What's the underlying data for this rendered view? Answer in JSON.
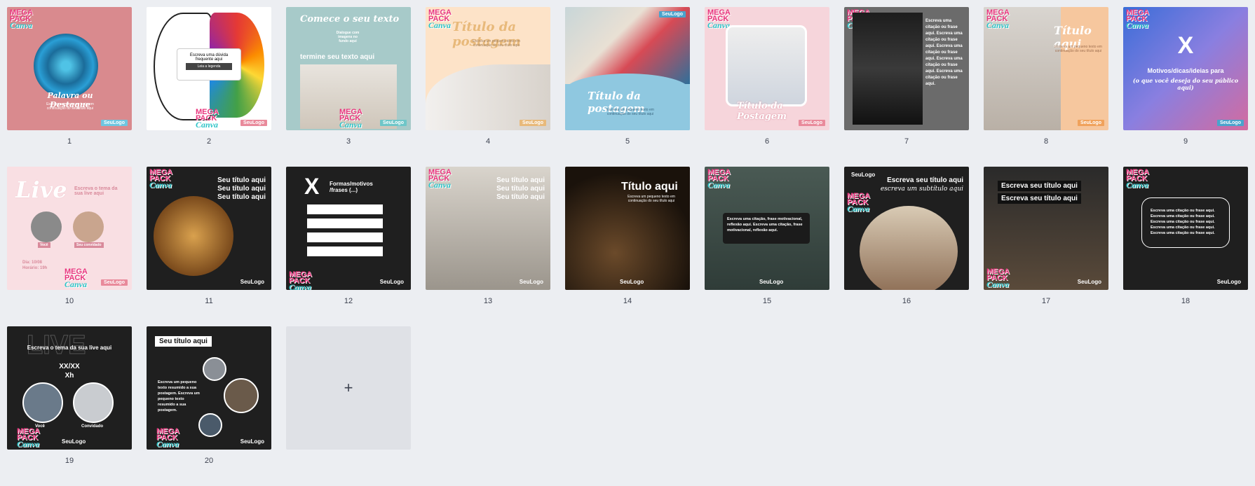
{
  "pages": [
    {
      "n": "1",
      "title": "Palavra ou Destaque",
      "body": "Escreva um pequeno texto em continuação do seu título aqui",
      "logo": "SeuLogo"
    },
    {
      "n": "2",
      "title": "Escreva uma dúvida frequente aqui",
      "button": "Leia a legenda",
      "logo": "SeuLogo"
    },
    {
      "n": "3",
      "title": "Comece o seu texto",
      "sub": "Dialogue com imagens no fundo aqui",
      "body": "termine seu texto aqui",
      "logo": "SeuLogo"
    },
    {
      "n": "4",
      "title": "Título da postagem",
      "body": "Escreva um pequeno texto em continuação do seu título aqui",
      "logo": "SeuLogo"
    },
    {
      "n": "5",
      "title": "Título da postagem",
      "body": "Escreva um pequeno texto em continuação do seu título aqui",
      "logo": "SeuLogo"
    },
    {
      "n": "6",
      "title": "Título da Postagem",
      "logo": "SeuLogo"
    },
    {
      "n": "7",
      "body": "Escreva uma citação ou frase aqui. Escreva uma citação ou frase aqui. Escreva uma citação ou frase aqui. Escreva uma citação ou frase aqui. Escreva uma citação ou frase aqui."
    },
    {
      "n": "8",
      "title": "Título aqui",
      "body": "Escreva um pequeno texto em continuação do seu título aqui",
      "logo": "SeuLogo"
    },
    {
      "n": "9",
      "big": "X",
      "title": "Motivos/dicas/ideias para",
      "body": "(o que você deseja do seu público aqui)",
      "logo": "SeuLogo"
    },
    {
      "n": "10",
      "title": "Live",
      "sub": "Escreva o tema da sua live aqui",
      "p1": "Você",
      "p2": "Seu convidado",
      "date": "Dia: 10/08",
      "hour": "Horário: 19h",
      "logo": "SeuLogo"
    },
    {
      "n": "11",
      "l1": "Seu título aqui",
      "l2": "Seu título aqui",
      "l3": "Seu título aqui",
      "logo": "SeuLogo"
    },
    {
      "n": "12",
      "big": "X",
      "title": "Formas/motivos /frases (...)",
      "logo": "SeuLogo"
    },
    {
      "n": "13",
      "l1": "Seu título aqui",
      "l2": "Seu título aqui",
      "l3": "Seu título aqui",
      "logo": "SeuLogo"
    },
    {
      "n": "14",
      "title": "Título aqui",
      "body": "Escreva um pequeno texto em continuação do seu título aqui",
      "logo": "SeuLogo"
    },
    {
      "n": "15",
      "body": "Escreva uma citação, frase motivacional, reflexão aqui. Escreva uma citação, frase motivacional, reflexão aqui.",
      "logo": "SeuLogo"
    },
    {
      "n": "16",
      "logo": "SeuLogo",
      "title": "Escreva seu título aqui",
      "sub": "escreva um subtítulo aqui"
    },
    {
      "n": "17",
      "l1": "Escreva seu título aqui",
      "l2": "Escreva seu título aqui",
      "logo": "SeuLogo"
    },
    {
      "n": "18",
      "body": "Escreva uma citação ou frase aqui. Escreva uma citação ou frase aqui. Escreva uma citação ou frase aqui. Escreva uma citação ou frase aqui. Escreva uma citação ou frase aqui.",
      "logo": "SeuLogo"
    },
    {
      "n": "19",
      "bg": "LIVE",
      "title": "Escreva o tema da sua live aqui",
      "date": "XX/XX",
      "hour": "Xh",
      "p1": "Você",
      "p2": "Convidado",
      "logo": "SeuLogo"
    },
    {
      "n": "20",
      "title": "Seu título aqui",
      "body": "Escreva um pequeno texto resumido a sua postagem. Escreva um pequeno texto resumido a sua postagem.",
      "logo": "SeuLogo"
    }
  ],
  "brand": {
    "l1": "MEGA",
    "l2": "PACK",
    "l3": "Canva"
  },
  "add_page": {
    "icon": "plus-icon",
    "label": "+"
  }
}
